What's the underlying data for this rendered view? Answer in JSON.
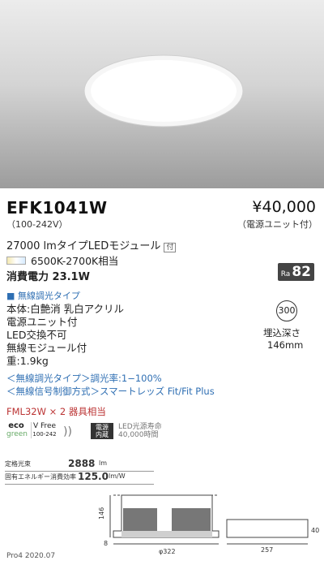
{
  "product": {
    "model": "EFK1041W",
    "voltage": "（100-242V）",
    "price": "¥40,000",
    "price_note": "（電源ユニット付）",
    "module": "27000 lmタイプLEDモジュール",
    "module_tag": "付",
    "color_temp": "6500K-2700K相当",
    "power": "消費電力 23.1W",
    "ra_label": "Ra",
    "ra_value": "82"
  },
  "specs": {
    "type": "■ 無線調光タイプ",
    "lines": [
      "本体:白艶消 乳白アクリル",
      "電源ユニット付",
      "LED交換不可",
      "無線モジュール付",
      "重:1.9kg"
    ],
    "dimming": "＜無線調光タイプ＞調光率:1−100%",
    "signal": "＜無線信号制御方式＞スマートレッズ Fit/Fit Plus",
    "fml": "FML32W × 2 器具相当"
  },
  "embed": {
    "hole": "300",
    "depth_label": "埋込深さ",
    "depth_value": "146mm"
  },
  "badges": {
    "eco_top": "eco",
    "eco_bottom": "green",
    "vfree_top": "V Free",
    "vfree_bottom": "100-242",
    "power_top": "電源",
    "power_bottom": "内蔵",
    "life_line1": "LED光源寿命",
    "life_line2": "40,000時間"
  },
  "table": {
    "row1_label": "定格光束",
    "row1_value": "2888",
    "row1_unit": "lm",
    "row2_label": "固有エネルギー消費効率",
    "row2_value": "125.0",
    "row2_unit": "lm/W"
  },
  "drawing": {
    "dim_height": "146",
    "dim_diameter": "φ322",
    "dim_length": "257",
    "dim_small": "8",
    "dim_right": "40"
  },
  "footer": "Pro4 2020.07"
}
